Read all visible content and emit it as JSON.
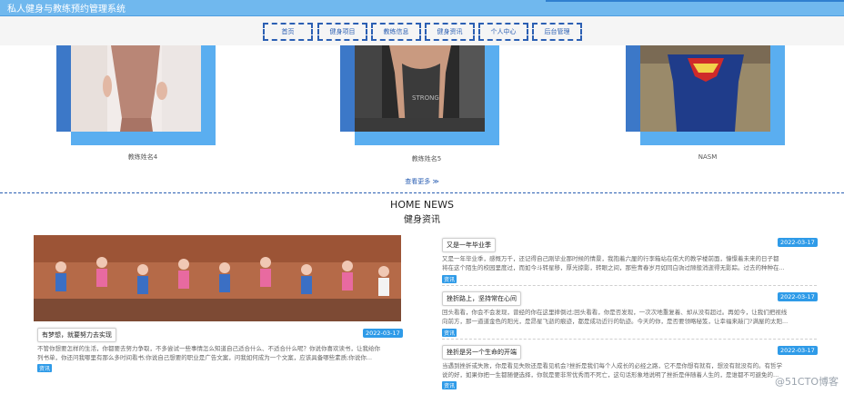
{
  "app": {
    "title": "私人健身与教练预约管理系统"
  },
  "nav": [
    {
      "label": "首页"
    },
    {
      "label": "健身项目"
    },
    {
      "label": "教练信息"
    },
    {
      "label": "健身资讯"
    },
    {
      "label": "个人中心"
    },
    {
      "label": "后台管理"
    }
  ],
  "coaches": [
    {
      "name": "教练姓名4"
    },
    {
      "name": "教练姓名5"
    },
    {
      "name": "NASM"
    }
  ],
  "more_label": "查看更多 ≫",
  "news_section": {
    "title_en": "HOME NEWS",
    "title_cn": "健身资讯"
  },
  "featured_news": {
    "title": "有梦想，就要努力去实现",
    "date": "2022-03-17",
    "body_1": "不管你想要怎样的生活，你都要去努力争取，不多尝试一些事情怎么知道自己适合什么、不适合什么呢？你说你喜欢读书，让我给你",
    "body_2": "列书单，你还问我哪里有那么多时间看书;你说自己想要的职业是广告文案，问我如何成为一个文案，应该具备哪些素质;你说你...",
    "tag": "资讯"
  },
  "news_list": [
    {
      "title": "又是一年毕业季",
      "date": "2022-03-17",
      "body_1": "又是一年毕业季，感慨万千，还记得自己刚毕业那时候的情景，我抱着六厘的行李箱站在偌大的教学楼前面，憧憬着未来的日子都",
      "body_2": "将在这个陌生的校园里度过，而如今斗转星移，厚光掠影，转眼之间，那些青春岁月如同白驹过隙般消逝得无影踪。过去的种种在...",
      "tag": "资讯"
    },
    {
      "title": "挫折路上，坚持常在心间",
      "date": "2022-03-17",
      "body_1": "回头看看，你会不会发现，曾经的你在这里摔倒过;回头看看，你是否发现，一次次地重复着、却从没有超过。再如今，让我们把视线",
      "body_2": "向前方，那一道道金色的阳光，是昂星飞逝的痕迹，都是成功近行的轨迹。今天的你，是否要领略秘笈，让幸福来敲门?满屋的太阳...",
      "tag": "资讯"
    },
    {
      "title": "挫折是另一个生命的开端",
      "date": "2022-03-17",
      "body_1": "当遇到挫折或失败，你是看见失败还是看见机会?挫折是我们每个人成长的必经之路，它不是你想有就有，想没有就没有的。有哲学",
      "body_2": "说的好，如果你把一生都随便选择，你就是要非常优秀而不死亡，这句话形象地说明了挫折是伴随着人生的，是谁都不可避免的...",
      "tag": "资讯"
    }
  ],
  "watermark": "@51CTO博客"
}
